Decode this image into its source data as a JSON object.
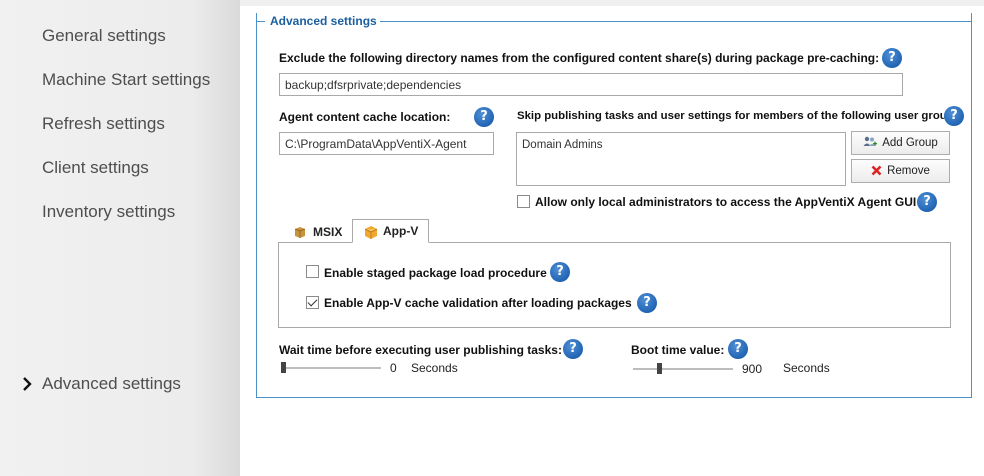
{
  "sidebar": {
    "items": [
      {
        "label": "General settings"
      },
      {
        "label": "Machine Start settings"
      },
      {
        "label": "Refresh settings"
      },
      {
        "label": "Client settings"
      },
      {
        "label": "Inventory settings"
      },
      {
        "label": "Advanced settings",
        "active": true
      }
    ]
  },
  "advanced": {
    "legend": "Advanced settings",
    "exclude_label": "Exclude the following directory names from the configured content share(s) during package pre-caching:",
    "exclude_value": "backup;dfsrprivate;dependencies",
    "cache_label": "Agent content cache location:",
    "cache_value": "C:\\ProgramData\\AppVentiX-Agent",
    "skip_label": "Skip publishing tasks and user settings for members of the following user groups:",
    "groups": [
      "Domain Admins"
    ],
    "add_group_label": "Add Group",
    "remove_label": "Remove",
    "allow_local_admins_label": "Allow only local administrators to access the AppVentiX Agent GUI",
    "allow_local_admins_checked": false,
    "help_glyph": "?"
  },
  "tabs": [
    {
      "label": "MSIX",
      "selected": false
    },
    {
      "label": "App-V",
      "selected": true
    }
  ],
  "appv": {
    "staged_label": "Enable staged package load procedure",
    "staged_checked": false,
    "cache_validation_label": "Enable App-V cache validation after loading packages",
    "cache_validation_checked": true
  },
  "wait": {
    "label": "Wait time before executing user publishing tasks:",
    "value": "0",
    "unit": "Seconds",
    "fraction": 0.0
  },
  "boot": {
    "label": "Boot time value:",
    "value": "900",
    "unit": "Seconds",
    "fraction": 0.25
  },
  "colors": {
    "accent": "#4a90c9",
    "legend_text": "#1b5fa0",
    "help_icon": "#2164b4"
  }
}
